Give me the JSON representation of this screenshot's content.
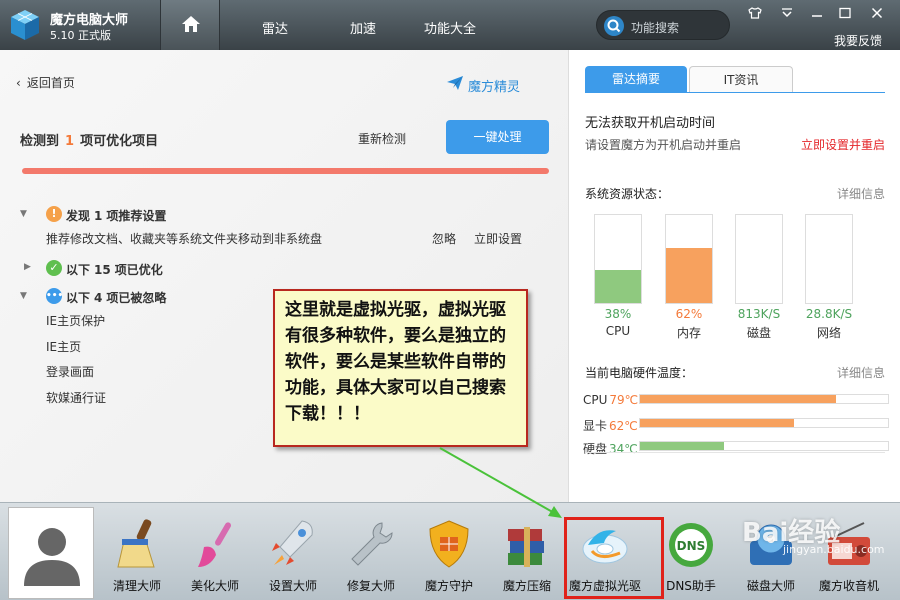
{
  "titlebar": {
    "app_name": "魔方电脑大师",
    "version": "5.10 正式版",
    "tabs": [
      "雷达",
      "加速",
      "功能大全"
    ],
    "search_placeholder": "功能搜索",
    "feedback": "我要反馈",
    "icons": [
      "home-icon",
      "shirt-icon",
      "chevron-down-icon",
      "minimize-icon",
      "maximize-icon",
      "close-icon"
    ]
  },
  "left": {
    "back": "返回首页",
    "spirit": "魔方精灵",
    "detect_prefix": "检测到",
    "detect_count": "1",
    "detect_suffix": "项可优化项目",
    "recheck": "重新检测",
    "one_click": "一键处理",
    "groups": [
      {
        "prefix": "发现",
        "count": "1",
        "suffix": "项推荐设置",
        "icon": "warning-icon"
      },
      {
        "prefix": "以下",
        "count": "15",
        "suffix": "项已优化",
        "icon": "check-icon"
      },
      {
        "prefix": "以下",
        "count": "4",
        "suffix": "项已被忽略",
        "icon": "ellipsis-icon"
      }
    ],
    "recommend_item": "推荐修改文档、收藏夹等系统文件夹移动到非系统盘",
    "ignore": "忽略",
    "set_now": "立即设置",
    "ignored_items": [
      "IE主页保护",
      "IE主页",
      "登录画面",
      "软媒通行证"
    ]
  },
  "right": {
    "tabs": [
      "雷达摘要",
      "IT资讯"
    ],
    "boot_title": "无法获取开机启动时间",
    "boot_hint": "请设置魔方为开机启动并重启",
    "boot_link": "立即设置并重启",
    "resource_title": "系统资源状态：",
    "details": "详细信息",
    "gauges": [
      {
        "value": "38%",
        "label": "CPU",
        "level": 38,
        "color": "#8fc97f"
      },
      {
        "value": "62%",
        "label": "内存",
        "level": 62,
        "color": "#f7a15e"
      },
      {
        "value": "813K/S",
        "label": "磁盘",
        "level": 0,
        "color": "#8fc97f"
      },
      {
        "value": "28.8K/S",
        "label": "网络",
        "level": 0,
        "color": "#8fc97f"
      }
    ],
    "temp_title": "当前电脑硬件温度：",
    "temps": [
      {
        "label": "CPU",
        "value": "79℃",
        "level": 79,
        "color": "#f7a15e",
        "text_color": "#f47a3a"
      },
      {
        "label": "显卡",
        "value": "62℃",
        "level": 62,
        "color": "#f7a15e",
        "text_color": "#f47a3a"
      },
      {
        "label": "硬盘",
        "value": "34℃",
        "level": 34,
        "color": "#8fc97f",
        "text_color": "#4ea35d"
      }
    ]
  },
  "annotation": "这里就是虚拟光驱，虚拟光驱有很多种软件，要么是独立的软件，要么是某些软件自带的功能，具体大家可以自己搜索下载！！！",
  "dock": {
    "tools": [
      "清理大师",
      "美化大师",
      "设置大师",
      "修复大师",
      "魔方守护",
      "魔方压缩",
      "魔方虚拟光驱",
      "DNS助手",
      "磁盘大师",
      "魔方收音机"
    ],
    "icons": [
      "broom-icon",
      "paintbrush-icon",
      "rocket-icon",
      "wrench-icon",
      "shield-icon",
      "archive-icon",
      "virtual-drive-icon",
      "dns-icon",
      "disk-icon",
      "radio-icon"
    ]
  },
  "watermark": {
    "text": "Bai经验",
    "url": "jingyan.baidu.com"
  }
}
